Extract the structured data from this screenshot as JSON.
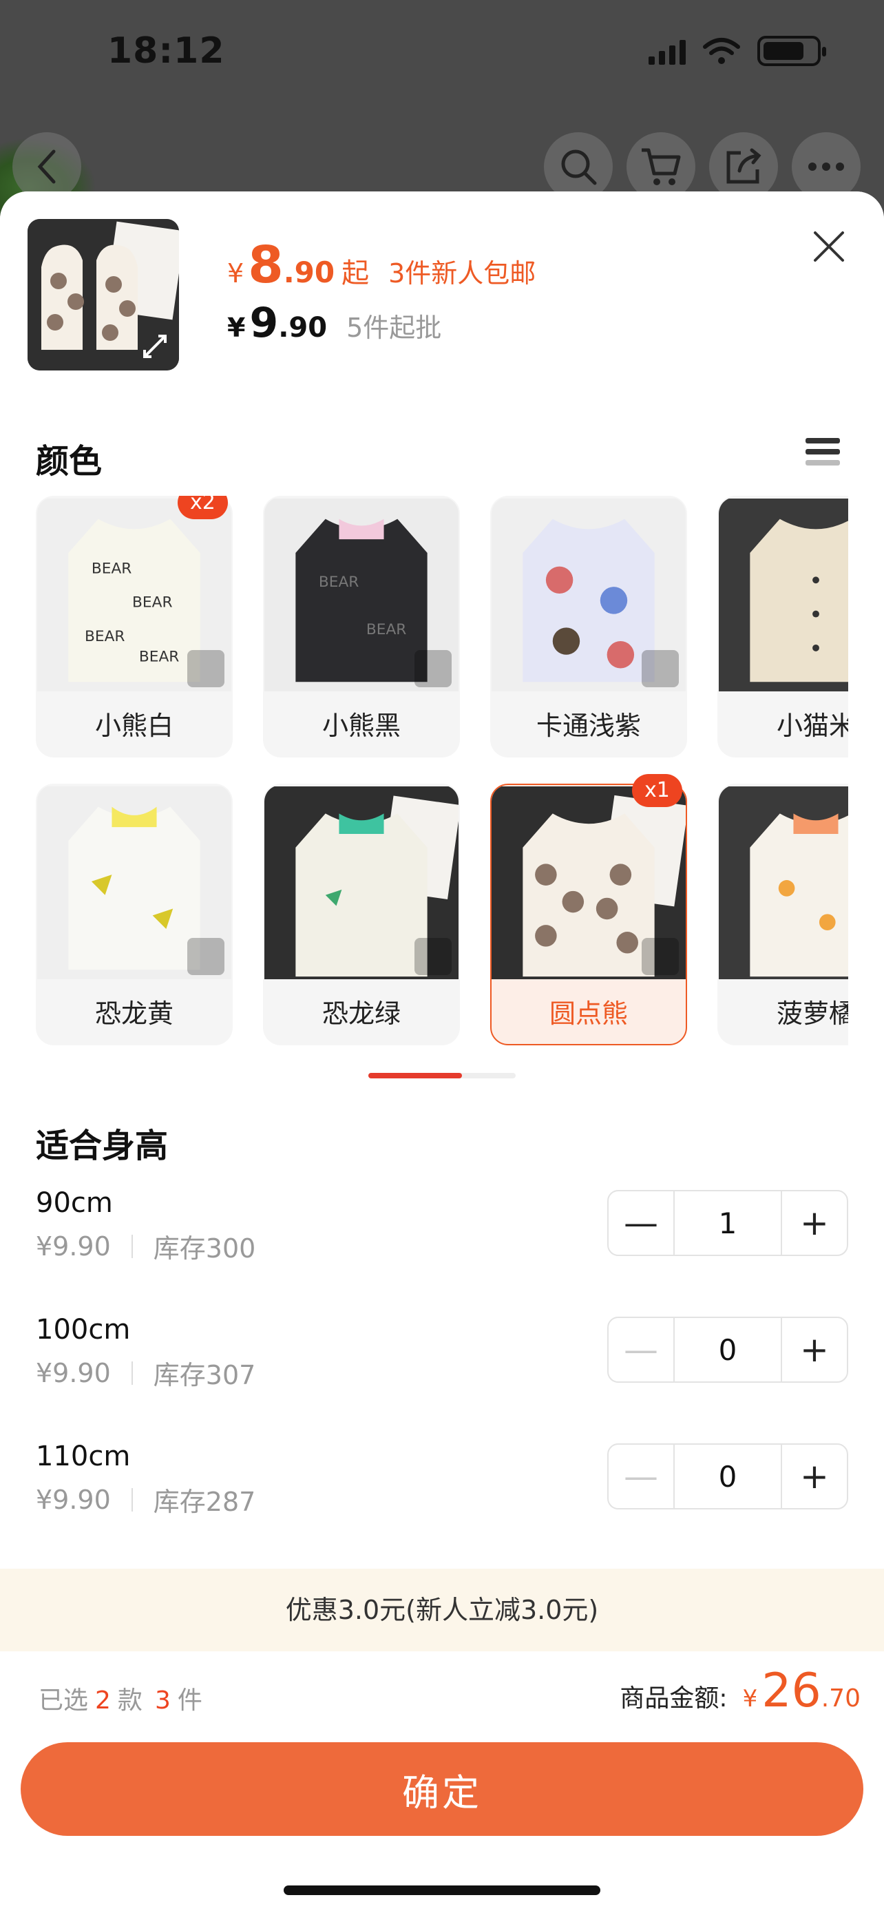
{
  "status": {
    "time": "18:12"
  },
  "product": {
    "price_currency": "¥",
    "price_int": "8",
    "price_dec": ".90",
    "price_qi": "起",
    "promo": "3件新人包邮",
    "wholesale_int": "9",
    "wholesale_dec": ".90",
    "moq": "5件起批"
  },
  "color_section": {
    "title": "颜色",
    "swatches": [
      {
        "label": "小熊白",
        "badge": "x2"
      },
      {
        "label": "小熊黑"
      },
      {
        "label": "卡通浅紫"
      },
      {
        "label": "小猫米"
      },
      {
        "label": "恐龙黄"
      },
      {
        "label": "恐龙绿"
      },
      {
        "label": "圆点熊",
        "badge": "x1"
      },
      {
        "label": "菠萝橘"
      }
    ]
  },
  "size_section": {
    "title": "适合身高",
    "rows": [
      {
        "name": "90cm",
        "price": "¥9.90",
        "stock": "库存300",
        "qty": "1"
      },
      {
        "name": "100cm",
        "price": "¥9.90",
        "stock": "库存307",
        "qty": "0"
      },
      {
        "name": "110cm",
        "price": "¥9.90",
        "stock": "库存287",
        "qty": "0"
      }
    ]
  },
  "discount_text": "优惠3.0元(新人立减3.0元)",
  "summary": {
    "chosen_prefix": "已选",
    "styles": "2",
    "styles_unit": "款",
    "pieces": "3",
    "pieces_unit": "件",
    "amount_label": "商品金额:",
    "amount_currency": "¥",
    "amount_int": "26",
    "amount_dec": ".70"
  },
  "confirm_label": "确定",
  "colors": {
    "accent": "#ee5a24",
    "button": "#ee6a3b",
    "badge": "#ee4420"
  }
}
